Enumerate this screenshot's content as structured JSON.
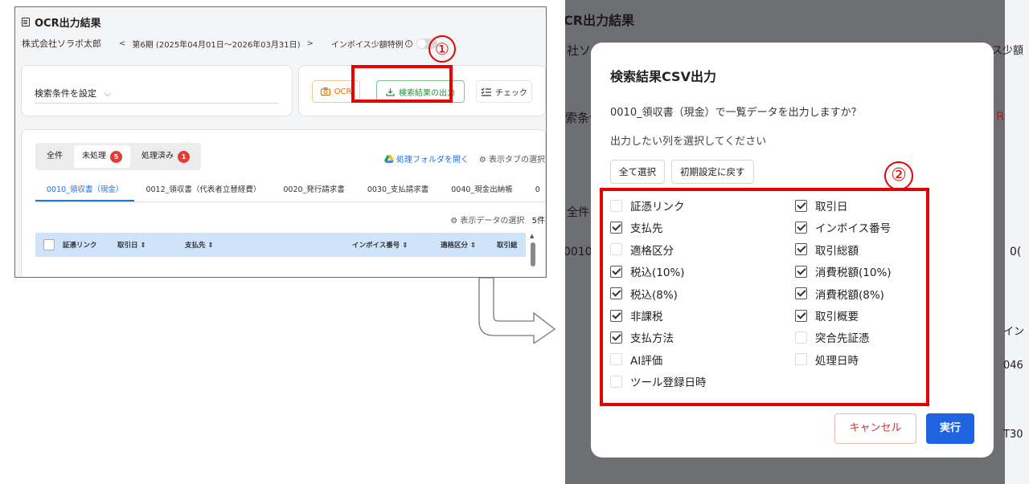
{
  "left": {
    "title": "OCR出力結果",
    "company": "株式会社ソラボ太郎",
    "period": "第6期 (2025年04月01日〜2026年03月31日)",
    "prev": "<",
    "next": ">",
    "invoice_label": "インボイス少額特例",
    "info": "i",
    "search_condition": "検索条件を設定",
    "search_chevron": "⌵",
    "btn_ocr": "OCR",
    "btn_export": "検索結果の出力",
    "btn_check": "チェック",
    "step1": "①",
    "tabs": [
      {
        "label": "全件"
      },
      {
        "label": "未処理",
        "badge": "5"
      },
      {
        "label": "処理済み",
        "badge": "1"
      }
    ],
    "folder_link": "処理フォルダを開く",
    "tab_select": "⚙ 表示タブの選択",
    "subtabs": [
      "0010_領収書（現金）",
      "0012_領収書（代表者立替経費）",
      "0020_発行請求書",
      "0030_支払請求書",
      "0040_現金出納帳",
      "0"
    ],
    "data_select": "⚙ 表示データの選択",
    "count": "5件",
    "columns": [
      "証憑リンク",
      "取引日 ⇕",
      "支払先 ⇕",
      "インボイス番号 ⇕",
      "適格区分 ⇕",
      "取引総"
    ]
  },
  "right": {
    "bg_title": "CR出力結果",
    "bg_company": "社ソ",
    "bg_small": "ス少額",
    "bg_search": "索条件",
    "bg_r": "R",
    "bg_all": "全件",
    "bg_0010": "0010_",
    "bg_0": "0(",
    "bg_in": "イン",
    "bg_046": "046",
    "bg_t30": "T30",
    "modal": {
      "title": "検索結果CSV出力",
      "question": "0010_領収書（現金）で一覧データを出力しますか？",
      "hint": "出力したい列を選択してください",
      "select_all": "全て選択",
      "reset": "初期設定に戻す",
      "step2": "②",
      "cancel": "キャンセル",
      "run": "実行",
      "left_col": [
        {
          "label": "証憑リンク",
          "checked": false
        },
        {
          "label": "支払先",
          "checked": true
        },
        {
          "label": "適格区分",
          "checked": false
        },
        {
          "label": "税込(10%)",
          "checked": true
        },
        {
          "label": "税込(8%)",
          "checked": true
        },
        {
          "label": "非課税",
          "checked": true
        },
        {
          "label": "支払方法",
          "checked": true
        },
        {
          "label": "AI評価",
          "checked": false
        },
        {
          "label": "ツール登録日時",
          "checked": false
        }
      ],
      "right_col": [
        {
          "label": "取引日",
          "checked": true
        },
        {
          "label": "インボイス番号",
          "checked": true
        },
        {
          "label": "取引総額",
          "checked": true
        },
        {
          "label": "消費税額(10%)",
          "checked": true
        },
        {
          "label": "消費税額(8%)",
          "checked": true
        },
        {
          "label": "取引概要",
          "checked": true
        },
        {
          "label": "突合先証憑",
          "checked": false
        },
        {
          "label": "処理日時",
          "checked": false
        }
      ]
    }
  },
  "colors": {
    "accent": "#1f63e0",
    "highlight": "#e60000",
    "header": "#cfe3fb"
  }
}
